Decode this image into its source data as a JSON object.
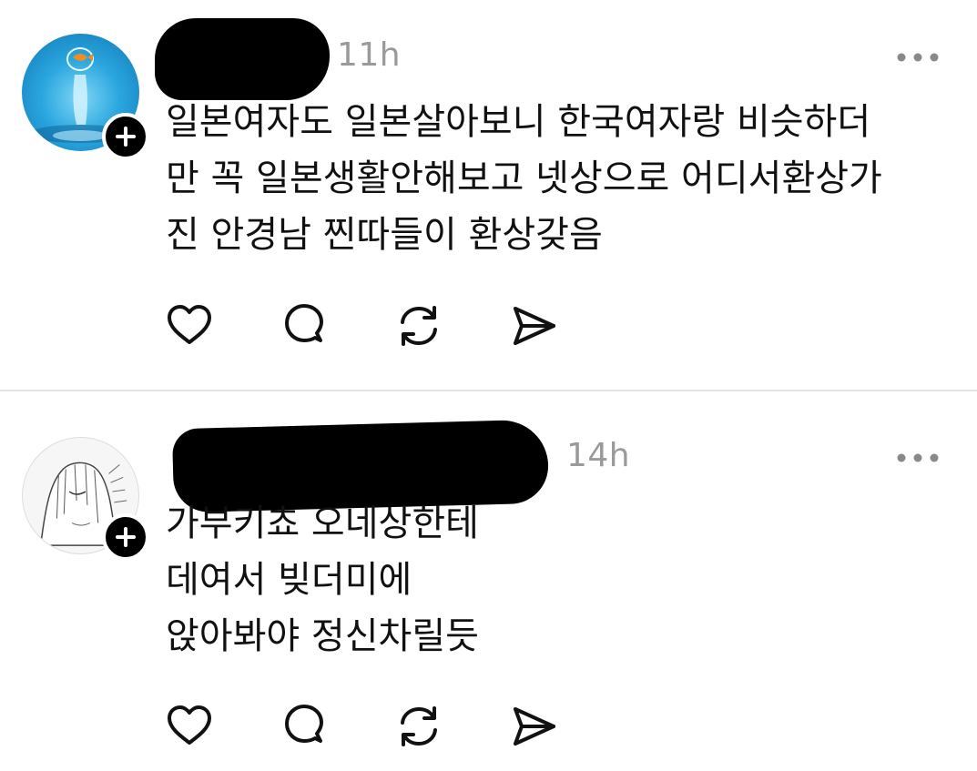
{
  "posts": [
    {
      "time": "11h",
      "lines": [
        "일본여자도 일본살아보니 한국여자랑 비슷하더",
        "만  꼭 일본생활안해보고 넷상으로 어디서환상가",
        "진 안경남 찐따들이 환상갖음"
      ]
    },
    {
      "time": "14h",
      "lines": [
        "가부키쵸 오네상한테",
        "데여서 빚더미에",
        "앉아봐야 정신차릴듯"
      ]
    }
  ],
  "icons": {
    "like": "heart-icon",
    "reply": "speech-bubble-icon",
    "repost": "repost-icon",
    "share": "send-icon",
    "more": "more-dots-icon",
    "follow": "plus-icon"
  },
  "colors": {
    "timestamp": "#9a9a9a",
    "text": "#111111",
    "divider": "#e4e4e4"
  }
}
